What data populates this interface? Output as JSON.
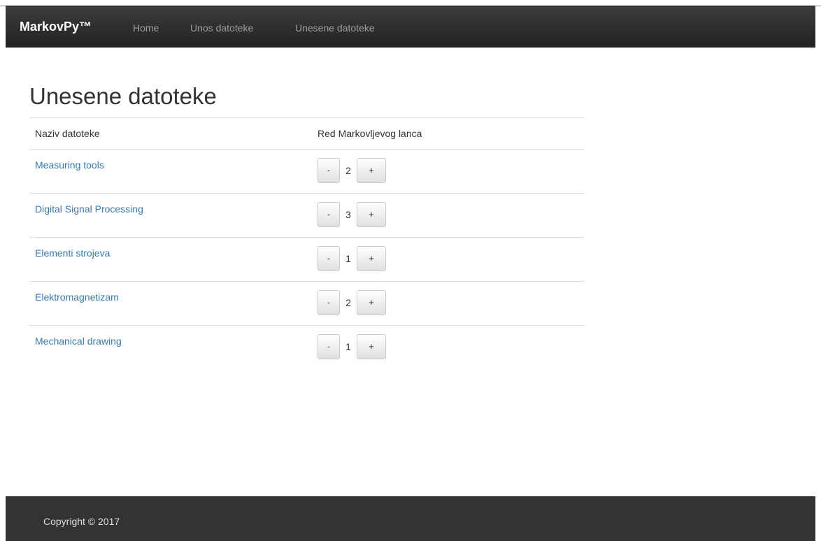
{
  "navbar": {
    "brand": "MarkovPy™",
    "links": [
      "Home",
      "Unos datoteke",
      "Unesene datoteke"
    ]
  },
  "page": {
    "title": "Unesene datoteke"
  },
  "table": {
    "headers": [
      "Naziv datoteke",
      "Red Markovljevog lanca"
    ],
    "rows": [
      {
        "name": "Measuring tools",
        "order": "2"
      },
      {
        "name": "Digital Signal Processing",
        "order": "3"
      },
      {
        "name": "Elementi strojeva",
        "order": "1"
      },
      {
        "name": "Elektromagnetizam",
        "order": "2"
      },
      {
        "name": "Mechanical drawing",
        "order": "1"
      }
    ],
    "decrement_label": "-",
    "increment_label": "+"
  },
  "footer": {
    "text": "Copyright © 2017"
  },
  "colors": {
    "navbar_bg": "#222222",
    "link": "#337ab7",
    "footer_bg": "#333333"
  }
}
